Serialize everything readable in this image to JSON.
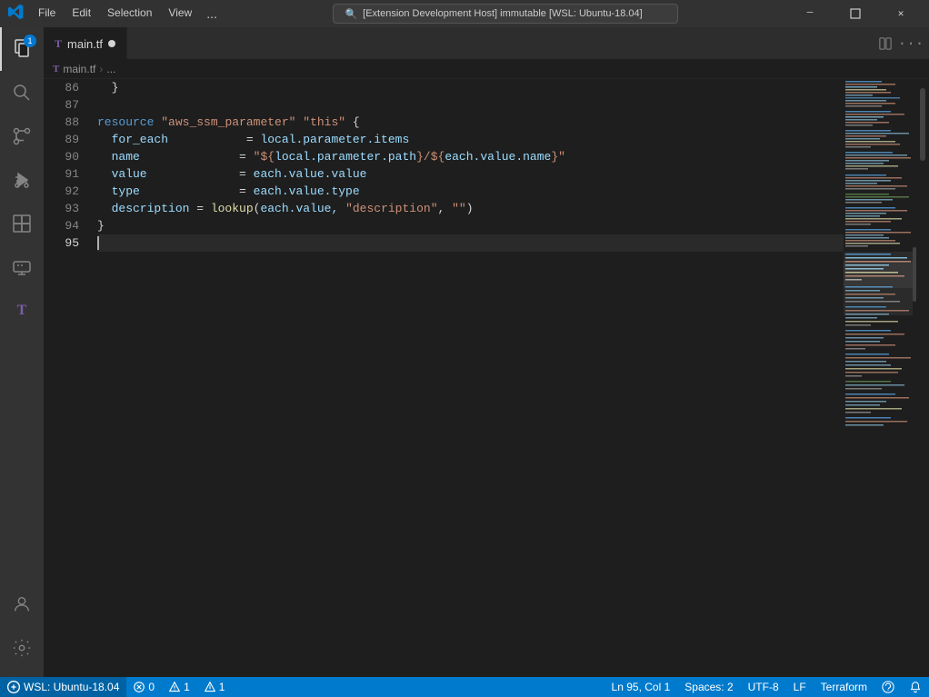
{
  "titlebar": {
    "menu_items": [
      "File",
      "Edit",
      "Selection",
      "View",
      "..."
    ],
    "search_text": "[Extension Development Host] immutable [WSL: Ubuntu-18.04]",
    "win_btns": [
      "─",
      "□",
      "✕"
    ]
  },
  "activity_bar": {
    "icons": [
      {
        "name": "explorer-icon",
        "symbol": "📄",
        "badge": "1",
        "active": true
      },
      {
        "name": "search-icon",
        "symbol": "🔍",
        "active": false
      },
      {
        "name": "source-control-icon",
        "symbol": "⎇",
        "active": false
      },
      {
        "name": "run-debug-icon",
        "symbol": "▷",
        "active": false
      },
      {
        "name": "extensions-icon",
        "symbol": "⊞",
        "active": false
      },
      {
        "name": "remote-icon",
        "symbol": "🖥",
        "active": false
      },
      {
        "name": "terraform-icon",
        "symbol": "T",
        "active": false
      }
    ],
    "bottom_icons": [
      {
        "name": "accounts-icon",
        "symbol": "👤"
      },
      {
        "name": "settings-icon",
        "symbol": "⚙"
      }
    ]
  },
  "tabs": [
    {
      "label": "main.tf",
      "modified": true,
      "active": true,
      "icon_color": "#7b5ea7"
    }
  ],
  "breadcrumb": {
    "items": [
      "main.tf",
      "..."
    ]
  },
  "editor": {
    "lines": [
      {
        "num": 86,
        "content": [
          {
            "text": "  }",
            "class": "punct"
          }
        ]
      },
      {
        "num": 87,
        "content": []
      },
      {
        "num": 88,
        "content": [
          {
            "text": "resource",
            "class": "kw"
          },
          {
            "text": " ",
            "class": ""
          },
          {
            "text": "\"aws_ssm_parameter\"",
            "class": "str"
          },
          {
            "text": " ",
            "class": ""
          },
          {
            "text": "\"this\"",
            "class": "str"
          },
          {
            "text": " {",
            "class": "punct"
          }
        ]
      },
      {
        "num": 89,
        "content": [
          {
            "text": "  for_each",
            "class": "prop"
          },
          {
            "text": "           = ",
            "class": "op"
          },
          {
            "text": "local.parameter.items",
            "class": "var"
          }
        ]
      },
      {
        "num": 90,
        "content": [
          {
            "text": "  name",
            "class": "prop"
          },
          {
            "text": "              = ",
            "class": "op"
          },
          {
            "text": "\"${local.parameter.path}/${each.value.name}\"",
            "class": "str"
          }
        ]
      },
      {
        "num": 91,
        "content": [
          {
            "text": "  value",
            "class": "prop"
          },
          {
            "text": "             = ",
            "class": "op"
          },
          {
            "text": "each.value.value",
            "class": "var"
          }
        ]
      },
      {
        "num": 92,
        "content": [
          {
            "text": "  type",
            "class": "prop"
          },
          {
            "text": "              = ",
            "class": "op"
          },
          {
            "text": "each.value.type",
            "class": "var"
          }
        ]
      },
      {
        "num": 93,
        "content": [
          {
            "text": "  description",
            "class": "prop"
          },
          {
            "text": " = ",
            "class": "op"
          },
          {
            "text": "lookup",
            "class": "fn"
          },
          {
            "text": "(each.value, ",
            "class": "var"
          },
          {
            "text": "\"description\"",
            "class": "str"
          },
          {
            "text": ", ",
            "class": "punct"
          },
          {
            "text": "\"\"",
            "class": "str"
          },
          {
            "text": ")",
            "class": "punct"
          }
        ]
      },
      {
        "num": 94,
        "content": [
          {
            "text": "}",
            "class": "punct"
          }
        ]
      },
      {
        "num": 95,
        "content": [],
        "active": true
      }
    ]
  },
  "statusbar": {
    "branch": "WSL: Ubuntu-18.04",
    "errors": "0",
    "warnings": "1",
    "info": "1",
    "position": "Ln 95, Col 1",
    "spaces": "Spaces: 2",
    "encoding": "UTF-8",
    "line_ending": "LF",
    "language": "Terraform",
    "feedback_icon": "🔔"
  }
}
